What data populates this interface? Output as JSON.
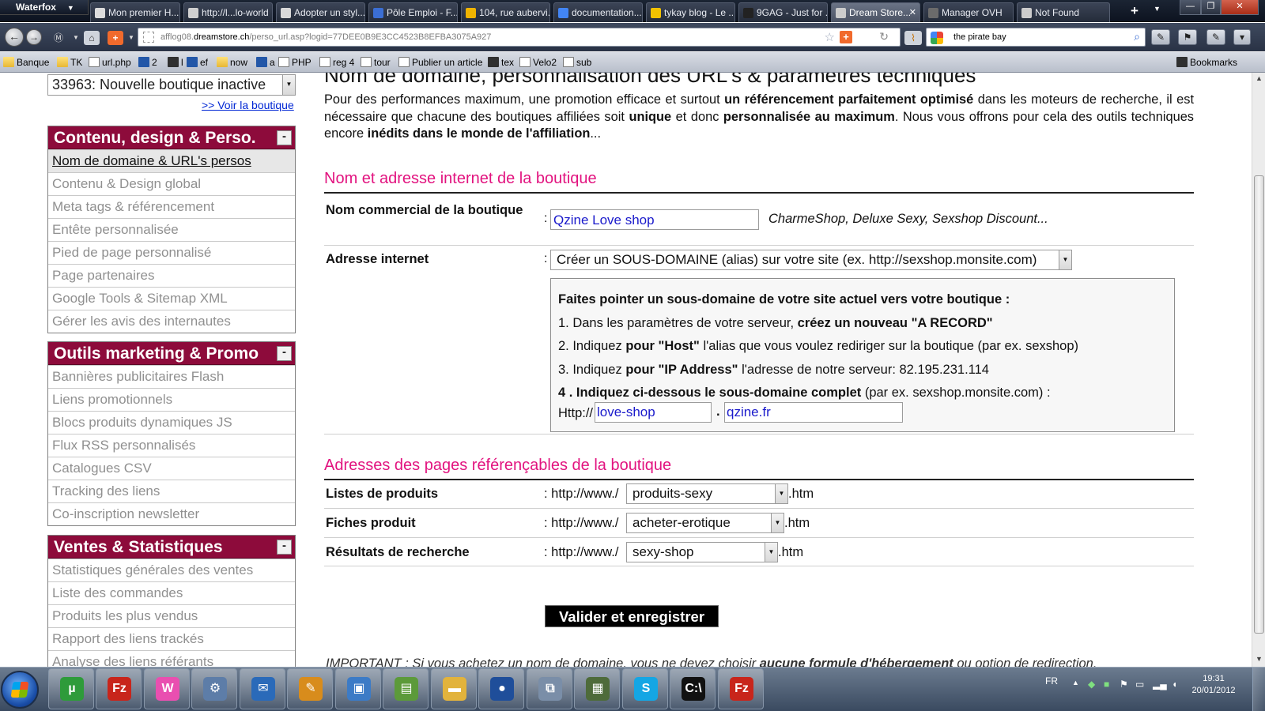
{
  "browser": {
    "app_name": "Waterfox",
    "tabs": [
      {
        "label": "Mon premier H...",
        "color": "#dcdcdc"
      },
      {
        "label": "http://l...lo-world",
        "color": "#d0d0d0"
      },
      {
        "label": "Adopter un styl...",
        "color": "#d9d9d9"
      },
      {
        "label": "Pôle Emploi - F...",
        "color": "#3b6ed3"
      },
      {
        "label": "104, rue aubervi...",
        "color": "#f0b400"
      },
      {
        "label": "documentation...",
        "color": "#4285f4"
      },
      {
        "label": "tykay blog - Le ...",
        "color": "#f2c200"
      },
      {
        "label": "9GAG - Just for ...",
        "color": "#222222"
      },
      {
        "label": "Dream Store...",
        "color": "#cccccc",
        "active": true
      },
      {
        "label": "Manager OVH",
        "color": "#6b6b6b"
      },
      {
        "label": "Not Found",
        "color": "#cccccc"
      }
    ],
    "url_prefix": "afflog08.",
    "url_domain": "dreamstore.ch",
    "url_path": "/perso_url.asp?logid=77DEE0B9E3CC4523B8EFBA3075A927",
    "search_value": "the pirate bay",
    "bookmarks": [
      {
        "label": "Banque",
        "icon": "folder"
      },
      {
        "label": "TK",
        "icon": "folder"
      },
      {
        "label": "url.php",
        "icon": "page"
      },
      {
        "label": "2",
        "icon": "flag"
      },
      {
        "label": "l",
        "icon": "dark"
      },
      {
        "label": "ef",
        "icon": "bluebox"
      },
      {
        "label": "now",
        "icon": "folder"
      },
      {
        "label": "a",
        "icon": "bluebox"
      },
      {
        "label": "PHP",
        "icon": "page"
      },
      {
        "label": "reg 4",
        "icon": "page"
      },
      {
        "label": "tour",
        "icon": "page"
      },
      {
        "label": "Publier un article",
        "icon": "page"
      },
      {
        "label": "tex",
        "icon": "dark"
      },
      {
        "label": "Velo2",
        "icon": "page"
      },
      {
        "label": "sub",
        "icon": "page"
      }
    ],
    "bookmarks_menu": "Bookmarks"
  },
  "sidebar": {
    "shop_select": "33963: Nouvelle boutique inactive",
    "view_shop_link": ">> Voir la boutique",
    "collapse_symbol": "-",
    "sections": [
      {
        "title": "Contenu, design & Perso.",
        "items": [
          "Nom de domaine & URL's persos",
          "Contenu & Design global",
          "Meta tags & référencement",
          "Entête personnalisée",
          "Pied de page personnalisé",
          "Page partenaires",
          "Google Tools & Sitemap XML",
          "Gérer les avis des internautes"
        ]
      },
      {
        "title": "Outils marketing & Promo",
        "items": [
          "Bannières publicitaires Flash",
          "Liens promotionnels",
          "Blocs produits dynamiques JS",
          "Flux RSS personnalisés",
          "Catalogues CSV",
          "Tracking des liens",
          "Co-inscription newsletter"
        ]
      },
      {
        "title": "Ventes & Statistiques",
        "items": [
          "Statistiques générales des ventes",
          "Liste des commandes",
          "Produits les plus vendus",
          "Rapport des liens trackés",
          "Analyse des liens référants"
        ]
      }
    ]
  },
  "main": {
    "title": "Nom de domaine, personnalisation des URL's & paramètres techniques",
    "intro": {
      "p1": "Pour des performances maximum, une promotion efficace et surtout ",
      "b1": "un référencement parfaitement optimisé",
      "p2": " dans les moteurs de recherche, il est nécessaire que chacune des boutiques affiliées soit ",
      "b2": "unique",
      "p3": " et donc ",
      "b3": "personnalisée au maximum",
      "p4": ". Nous vous offrons pour cela des outils techniques encore ",
      "b4": "inédits dans le monde de l'affiliation",
      "p5": "..."
    },
    "section1": {
      "title": "Nom et adresse internet de la boutique",
      "name_label": "Nom commercial de la boutique",
      "name_value": "Qzine Love shop",
      "name_hint": "CharmeShop, Deluxe Sexy, Sexshop Discount...",
      "address_label": "Adresse internet",
      "address_select": "Créer un SOUS-DOMAINE (alias) sur votre site (ex. http://sexshop.monsite.com)",
      "howto_title": "Faites pointer un sous-domaine de votre site actuel vers votre boutique :",
      "step1_a": "1. Dans les paramètres de votre serveur, ",
      "step1_b": "créez un nouveau \"A RECORD\"",
      "step2_a": "2. Indiquez ",
      "step2_b": "pour \"Host\"",
      "step2_c": " l'alias que vous voulez rediriger sur la boutique (par ex. sexshop)",
      "step3_a": "3. Indiquez ",
      "step3_b": "pour \"IP Address\"",
      "step3_c": " l'adresse de notre serveur: 82.195.231.114",
      "step4_a": "4 . Indiquez ci-dessous le sous-domaine complet",
      "step4_b": " (par ex. sexshop.monsite.com) :",
      "http_label": "Http://",
      "subdomain_value": "love-shop",
      "dot": ".",
      "domain_value": "qzine.fr"
    },
    "section2": {
      "title": "Adresses des pages référençables de la boutique",
      "prefix": ": http://www./",
      "suffix": ".htm",
      "rows": [
        {
          "label": "Listes de produits",
          "value": "produits-sexy"
        },
        {
          "label": "Fiches produit",
          "value": "acheter-erotique"
        },
        {
          "label": "Résultats de recherche",
          "value": "sexy-shop"
        }
      ]
    },
    "colon": ":",
    "submit_label": "Valider et enregistrer",
    "important": {
      "a": "IMPORTANT : Si vous achetez un nom de domaine, vous ne devez choisir ",
      "b": "aucune formule d'hébergement",
      "c": " ou option de redirection."
    }
  },
  "taskbar": {
    "apps": [
      {
        "name": "utorrent",
        "label": "µ",
        "color": "#2e9b3a"
      },
      {
        "name": "filezilla",
        "label": "Fz",
        "color": "#c8251b"
      },
      {
        "name": "wampserver",
        "label": "W",
        "color": "#e94fb0"
      },
      {
        "name": "network-tool",
        "label": "⚙",
        "color": "#5d7da8"
      },
      {
        "name": "thunderbird",
        "label": "✉",
        "color": "#2a6ab9"
      },
      {
        "name": "notepad-plus",
        "label": "✎",
        "color": "#d88c1c"
      },
      {
        "name": "virtualbox",
        "label": "▣",
        "color": "#3c7bc6"
      },
      {
        "name": "gnumeric",
        "label": "▤",
        "color": "#5c9a3a"
      },
      {
        "name": "explorer",
        "label": "▬",
        "color": "#e2b33c"
      },
      {
        "name": "waterfox",
        "label": "●",
        "color": "#1f4e9a"
      },
      {
        "name": "remote-desktop",
        "label": "⧉",
        "color": "#7a8ea8"
      },
      {
        "name": "putty",
        "label": "▦",
        "color": "#4e6b3a"
      },
      {
        "name": "skype",
        "label": "S",
        "color": "#14a6e4"
      },
      {
        "name": "cmd",
        "label": "C:\\",
        "color": "#111111"
      },
      {
        "name": "filezilla-2",
        "label": "Fz",
        "color": "#c8251b"
      }
    ],
    "lang": "FR",
    "time": "19:31",
    "date": "20/01/2012"
  }
}
